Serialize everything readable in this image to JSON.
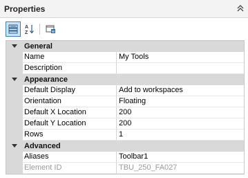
{
  "panel": {
    "title": "Properties",
    "collapse_icon": "double-chevron-up-icon"
  },
  "toolbar": {
    "buttons": [
      {
        "name": "categorized-view",
        "icon": "categorized-icon",
        "active": true
      },
      {
        "name": "alphabetical-sort",
        "icon": "sort-az-icon",
        "active": false
      },
      {
        "name": "property-pages",
        "icon": "property-pages-icon",
        "active": false
      }
    ]
  },
  "categories": [
    {
      "label": "General",
      "properties": [
        {
          "name": "Name",
          "value": "My Tools"
        },
        {
          "name": "Description",
          "value": ""
        }
      ]
    },
    {
      "label": "Appearance",
      "properties": [
        {
          "name": "Default Display",
          "value": "Add to workspaces"
        },
        {
          "name": "Orientation",
          "value": "Floating"
        },
        {
          "name": "Default X Location",
          "value": "200"
        },
        {
          "name": "Default Y Location",
          "value": "200"
        },
        {
          "name": "Rows",
          "value": "1"
        }
      ]
    },
    {
      "label": "Advanced",
      "properties": [
        {
          "name": "Aliases",
          "value": "Toolbar1"
        },
        {
          "name": "Element ID",
          "value": "TBU_250_FA027",
          "disabled": true
        }
      ]
    }
  ],
  "colors": {
    "category_bg": "#d9d9d9",
    "active_button_bg": "#cce4f7",
    "active_button_border": "#3c7fb1",
    "disabled_text": "#9a9a9a"
  }
}
